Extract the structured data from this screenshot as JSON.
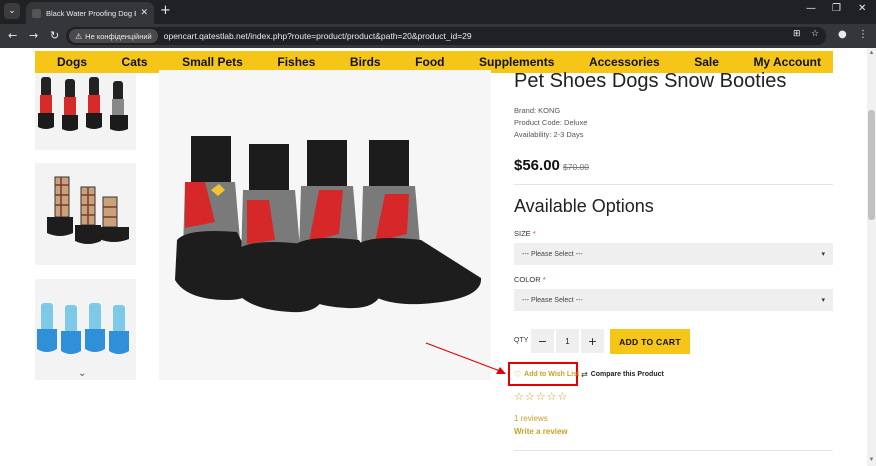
{
  "browser": {
    "tab_title": "Black Water Proofing Dog Booti",
    "tab_menu_icon": "chevron-down-icon",
    "new_tab_icon": "plus-icon",
    "security_label": "Не конфіденційний",
    "url": "opencart.qatestlab.net/index.php?route=product/product&path=20&product_id=29"
  },
  "nav": {
    "items": [
      {
        "label": "Dogs"
      },
      {
        "label": "Cats"
      },
      {
        "label": "Small Pets"
      },
      {
        "label": "Fishes"
      },
      {
        "label": "Birds"
      },
      {
        "label": "Food"
      },
      {
        "label": "Supplements"
      },
      {
        "label": "Accessories"
      },
      {
        "label": "Sale"
      },
      {
        "label": "My Account"
      }
    ]
  },
  "product": {
    "title": "Pet Shoes Dogs Snow Booties",
    "brand": "Brand: KONG",
    "code": "Product Code: Deluxe",
    "availability": "Availability: 2-3 Days",
    "price": "$56.00",
    "old_price": "$70.00",
    "options_title": "Available Options",
    "size_label": "SIZE",
    "size_placeholder": "--- Please Select ---",
    "color_label": "COLOR",
    "color_placeholder": "--- Please Select ---",
    "required_mark": "*",
    "qty_label": "QTY",
    "qty_value": "1",
    "add_to_cart": "ADD TO CART",
    "wishlist": "Add to Wish List",
    "compare": "Compare this Product",
    "reviews": "1 reviews",
    "write_review": "Write a review",
    "rating": 0
  },
  "colors": {
    "accent": "#f5c518",
    "gold_text": "#c9a227",
    "highlight": "#e60000"
  }
}
